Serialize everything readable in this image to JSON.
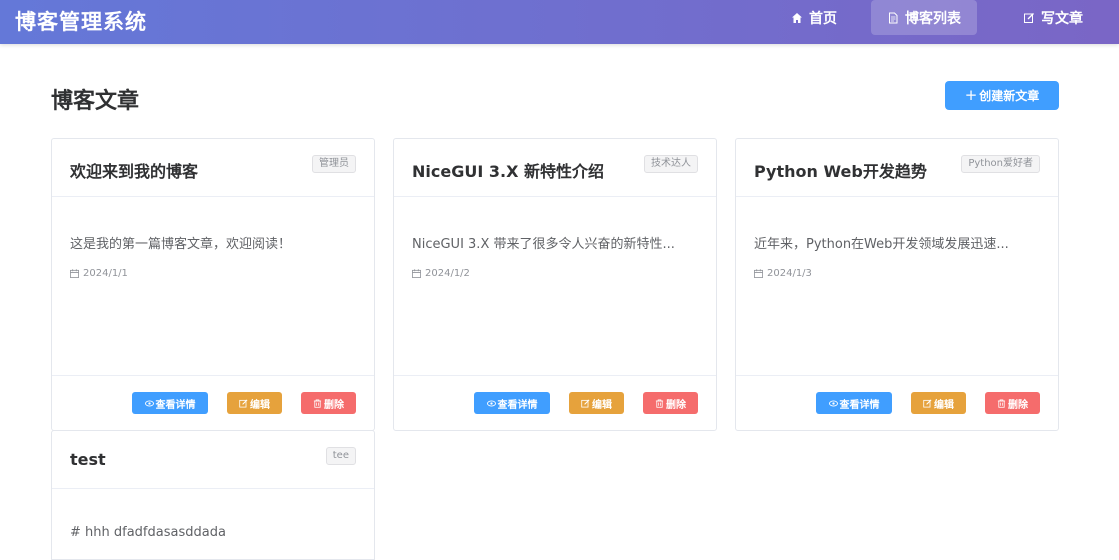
{
  "app": {
    "title": "博客管理系统"
  },
  "nav": {
    "items": [
      {
        "label": "首页",
        "icon": "home-icon",
        "active": false
      },
      {
        "label": "博客列表",
        "icon": "document-icon",
        "active": true
      },
      {
        "label": "写文章",
        "icon": "edit-icon",
        "active": false
      }
    ]
  },
  "main": {
    "title": "博客文章",
    "create_label": "创建新文章",
    "create_icon": "plus-icon"
  },
  "actions": {
    "view": "查看详情",
    "edit": "编辑",
    "delete": "删除"
  },
  "posts": [
    {
      "title": "欢迎来到我的博客",
      "tag": "管理员",
      "summary": "这是我的第一篇博客文章，欢迎阅读！",
      "date": "2024/1/1"
    },
    {
      "title": "NiceGUI 3.X 新特性介绍",
      "tag": "技术达人",
      "summary": "NiceGUI 3.X 带来了很多令人兴奋的新特性...",
      "date": "2024/1/2"
    },
    {
      "title": "Python Web开发趋势",
      "tag": "Python爱好者",
      "summary": "近年来，Python在Web开发领域发展迅速...",
      "date": "2024/1/3"
    },
    {
      "title": "test",
      "tag": "tee",
      "summary": "# hhh dfadfdasasddada",
      "date": ""
    }
  ],
  "colors": {
    "header_gradient_start": "#6478d8",
    "header_gradient_end": "#7a66c6",
    "primary": "#409eff",
    "warning": "#e6a23c",
    "danger": "#f56c6c"
  }
}
